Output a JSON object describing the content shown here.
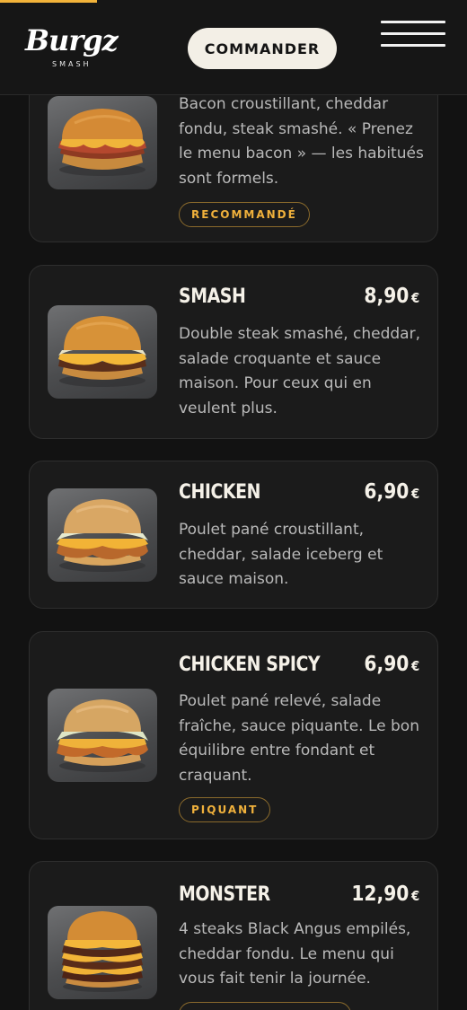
{
  "header": {
    "logo_word": "Burgz",
    "logo_sub": "SMASH",
    "order_label": "COMMANDER",
    "accent_color": "#f2b33a"
  },
  "currency": "€",
  "menu": [
    {
      "description": "Bacon croustillant, cheddar fondu, steak smashé. « Prenez le menu bacon » — les habitués sont formels.",
      "tag": "RECOMMANDÉ"
    },
    {
      "name": "SMASH",
      "price": "8,90",
      "description": "Double steak smashé, cheddar, salade croquante et sauce maison. Pour ceux qui en veulent plus."
    },
    {
      "name": "CHICKEN",
      "price": "6,90",
      "description": "Poulet pané croustillant, cheddar, salade iceberg et sauce maison."
    },
    {
      "name": "CHICKEN SPICY",
      "price": "6,90",
      "description": "Poulet pané relevé, salade fraîche, sauce piquante. Le bon équilibre entre fondant et craquant.",
      "tag": "PIQUANT"
    },
    {
      "name": "MONSTER",
      "price": "12,90",
      "description": "4 steaks Black Angus empilés, cheddar fondu. Le menu qui vous fait tenir la journée."
    }
  ]
}
